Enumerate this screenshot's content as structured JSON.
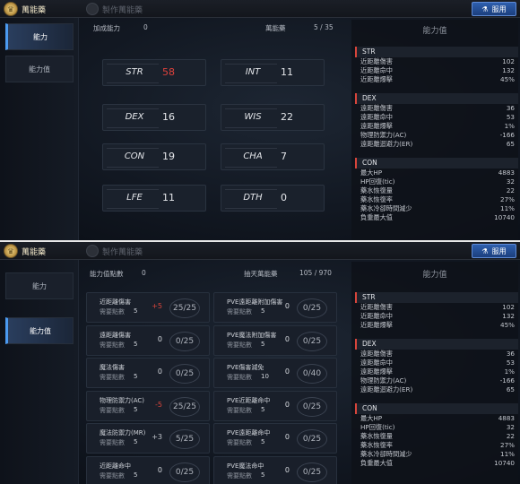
{
  "header": {
    "main_tab": "萬能藥",
    "craft_tab": "製作萬能藥",
    "use_button": "服用"
  },
  "panel1": {
    "nav": [
      "能力",
      "能力值"
    ],
    "bonus_label": "加成能力",
    "bonus_value": "0",
    "elixir_label": "萬能藥",
    "elixir_value": "5 / 35",
    "stats": [
      {
        "name": "STR",
        "value": "58",
        "highlight": true
      },
      {
        "name": "INT",
        "value": "11",
        "highlight": false
      },
      {
        "name": "DEX",
        "value": "16",
        "highlight": false
      },
      {
        "name": "WIS",
        "value": "22",
        "highlight": false
      },
      {
        "name": "CON",
        "value": "19",
        "highlight": false
      },
      {
        "name": "CHA",
        "value": "7",
        "highlight": false
      },
      {
        "name": "LFE",
        "value": "11",
        "highlight": false
      },
      {
        "name": "DTH",
        "value": "0",
        "highlight": false
      }
    ]
  },
  "panel2": {
    "nav": [
      "能力",
      "能力值"
    ],
    "points_label": "能力值點數",
    "points_value": "0",
    "limit_label": "抽天萬能藥",
    "limit_value": "105 / 970",
    "left_list": [
      {
        "name": "近距離傷害",
        "req_label": "需要點數",
        "req": "5",
        "cur": "+5",
        "count": "25/25",
        "style": "red"
      },
      {
        "name": "遠距離傷害",
        "req_label": "需要點數",
        "req": "5",
        "cur": "0",
        "count": "0/25",
        "style": ""
      },
      {
        "name": "魔法傷害",
        "req_label": "需要點數",
        "req": "5",
        "cur": "0",
        "count": "0/25",
        "style": ""
      },
      {
        "name": "物理防禦力(AC)",
        "req_label": "需要點數",
        "req": "5",
        "cur": "-5",
        "count": "25/25",
        "style": "red"
      },
      {
        "name": "魔法防禦力(MR)",
        "req_label": "需要點數",
        "req": "5",
        "cur": "+3",
        "count": "5/25",
        "style": "gr"
      },
      {
        "name": "近距離命中",
        "req_label": "需要點數",
        "req": "5",
        "cur": "0",
        "count": "0/25",
        "style": ""
      }
    ],
    "right_list": [
      {
        "name": "PVE遠距離附加傷害",
        "req_label": "需要點數",
        "req": "5",
        "cur": "0",
        "count": "0/25",
        "style": ""
      },
      {
        "name": "PVE魔法附加傷害",
        "req_label": "需要點數",
        "req": "5",
        "cur": "0",
        "count": "0/25",
        "style": ""
      },
      {
        "name": "PVE傷害減免",
        "req_label": "需要點數",
        "req": "10",
        "cur": "0",
        "count": "0/40",
        "style": ""
      },
      {
        "name": "PVE近距離命中",
        "req_label": "需要點數",
        "req": "5",
        "cur": "0",
        "count": "0/25",
        "style": ""
      },
      {
        "name": "PVE遠距離命中",
        "req_label": "需要點數",
        "req": "5",
        "cur": "0",
        "count": "0/25",
        "style": ""
      },
      {
        "name": "PVE魔法命中",
        "req_label": "需要點數",
        "req": "5",
        "cur": "0",
        "count": "0/25",
        "style": ""
      }
    ]
  },
  "summary": {
    "title": "能力值",
    "sections": [
      {
        "name": "STR",
        "rows": [
          [
            "近距離傷害",
            "102"
          ],
          [
            "近距離命中",
            "132"
          ],
          [
            "近距離爆擊",
            "45%"
          ]
        ]
      },
      {
        "name": "DEX",
        "rows": [
          [
            "遠距離傷害",
            "36"
          ],
          [
            "遠距離命中",
            "53"
          ],
          [
            "遠距離爆擊",
            "1%"
          ],
          [
            "物理防禦力(AC)",
            "-166"
          ],
          [
            "遠距離迴避力(ER)",
            "65"
          ]
        ]
      },
      {
        "name": "CON",
        "rows": [
          [
            "最大HP",
            "4883"
          ],
          [
            "HP回復(tic)",
            "32"
          ],
          [
            "藥水恢復量",
            "22"
          ],
          [
            "藥水恢復率",
            "27%"
          ],
          [
            "藥水冷卻時間減少",
            "11%"
          ],
          [
            "負重最大值",
            "10740"
          ]
        ]
      }
    ]
  }
}
